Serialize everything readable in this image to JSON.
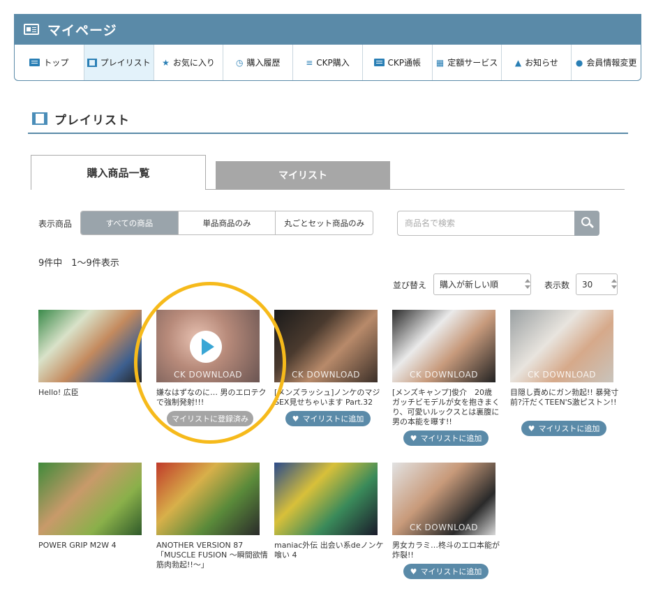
{
  "header": {
    "title": "マイページ",
    "icon": "id-card-icon"
  },
  "nav": [
    {
      "label": "トップ",
      "icon": "id-card-icon",
      "active": false
    },
    {
      "label": "プレイリスト",
      "icon": "film-icon",
      "active": true
    },
    {
      "label": "お気に入り",
      "icon": "star-icon",
      "active": false
    },
    {
      "label": "購入履歴",
      "icon": "clock-icon",
      "active": false
    },
    {
      "label": "CKP購入",
      "icon": "coins-icon",
      "active": false
    },
    {
      "label": "CKP通帳",
      "icon": "passbook-icon",
      "active": false
    },
    {
      "label": "定額サービス",
      "icon": "calendar-icon",
      "active": false
    },
    {
      "label": "お知らせ",
      "icon": "bell-icon",
      "active": false
    },
    {
      "label": "会員情報変更",
      "icon": "user-icon",
      "active": false
    }
  ],
  "page_title": "プレイリスト",
  "tabs": {
    "tab1": "購入商品一覧",
    "tab2": "マイリスト"
  },
  "filter": {
    "label": "表示商品",
    "options": [
      "すべての商品",
      "単品商品のみ",
      "丸ごとセット商品のみ"
    ],
    "selected": "すべての商品"
  },
  "search": {
    "placeholder": "商品名で検索"
  },
  "count": "9件中　1〜9件表示",
  "sort": {
    "label": "並び替え",
    "value": "購入が新しい順",
    "per_label": "表示数",
    "per_value": "30"
  },
  "buttons": {
    "add": "マイリストに追加",
    "done": "マイリストに登録済み"
  },
  "thumb_caption": "CK DOWNLOAD",
  "products": [
    {
      "title": "Hello! 広臣",
      "status": "none"
    },
    {
      "title": "嫌なはずなのに… 男のエロテクで強制発射!!!",
      "status": "done"
    },
    {
      "title": "[メンズラッシュ]ノンケのマジSEX見せちゃいます Part.32",
      "status": "add"
    },
    {
      "title": "[メンズキャンプ]俊介　20歳　ガッチビモデルが女を抱きまくり、可愛いルックスとは裏腹に男の本能を曝す!!",
      "status": "add"
    },
    {
      "title": "目隠し責めにガン勃起!! 暴発寸前?汗だくTEEN'S激ピストン!!",
      "status": "add"
    },
    {
      "title": "POWER GRIP M2W 4",
      "status": "none"
    },
    {
      "title": "ANOTHER VERSION 87 「MUSCLE FUSION ～瞬間欲情筋肉勃起!!～」",
      "status": "none"
    },
    {
      "title": "maniac外伝 出会い系deノンケ喰い 4",
      "status": "none"
    },
    {
      "title": "男女カラミ…柊斗のエロ本能が炸裂!!",
      "status": "add"
    }
  ]
}
